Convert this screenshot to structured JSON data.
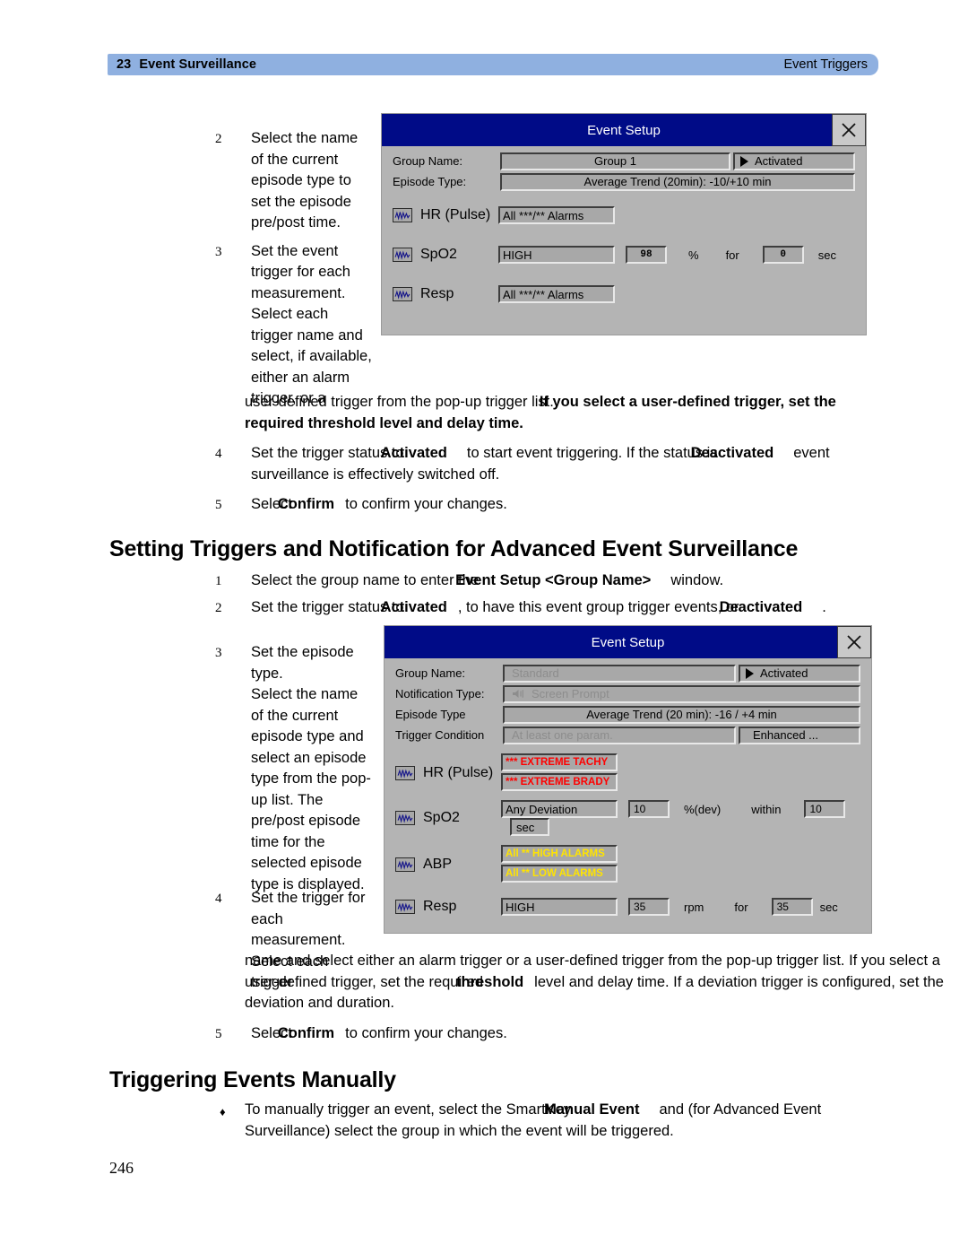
{
  "header": {
    "chapter_number": "23",
    "chapter_title": "Event Surveillance",
    "section_title": "Event Triggers"
  },
  "page_number": "246",
  "section_a": {
    "steps": [
      {
        "num": "2",
        "text": "Select the name of the current episode type to set the episode pre/post time."
      },
      {
        "num": "3",
        "text_narrow": "Set the event trigger for each measurement. Select each trigger name and select, if available, either an alarm trigger, or a",
        "text_wide_a": "user-defined trigger from the pop-up trigger list.",
        "text_wide_b": "If you select a user-defined trigger, set the required threshold level and delay time."
      },
      {
        "num": "4",
        "pre": "Set the trigger status to",
        "bold1": "Activated",
        "mid": "to start event triggering. If the status is",
        "bold2": "Deactivated",
        "post": "event surveillance is effectively switched off."
      },
      {
        "num": "5",
        "pre": "Select",
        "bold1": "Confirm",
        "mid": "to confirm your changes."
      }
    ]
  },
  "heading_advanced": "Setting Triggers and Notification for Advanced Event Surveillance",
  "section_b": {
    "steps": [
      {
        "num": "1",
        "pre": "Select the group name to enter the",
        "bold1": "Event Setup <Group Name>",
        "mid": "window."
      },
      {
        "num": "2",
        "pre": "Set the trigger status to",
        "bold1": "Activated",
        "mid": ", to have this event group trigger events, or",
        "bold2": "Deactivated",
        "post": "."
      },
      {
        "num": "3",
        "text_narrow": "Set the episode type.",
        "text_narrow2": "Select the name of the current episode type and select an episode type from the pop-up list. The pre/post episode time for the selected episode type is displayed."
      },
      {
        "num": "4",
        "text_narrow": "Set the trigger for each measurement. Select each trigger",
        "text_wide_a": "name and select either an alarm trigger or a user-defined trigger from the pop-up trigger list. If you select a user-defined trigger, set the required",
        "bold_threshold": "threshold",
        "text_wide_b": "level and delay time. If a deviation trigger is configured, set the deviation and duration."
      },
      {
        "num": "5",
        "pre": "Select",
        "bold1": "Confirm",
        "mid": "to confirm your changes."
      }
    ]
  },
  "heading_manual": "Triggering Events Manually",
  "section_c": {
    "bullet_glyph": "♦",
    "pre": "To manually trigger an event, select the SmartKey",
    "bold1": "Manual Event",
    "mid": "and (for Advanced Event Surveillance) select the group in which the event will be triggered."
  },
  "dialog_basic": {
    "title": "Event Setup",
    "close_icon": "close-icon",
    "fields": [
      {
        "label": "Group Name:",
        "value": "Group 1",
        "button": "Activated",
        "has_arrow": true
      },
      {
        "label": "Episode Type:",
        "value": "Average Trend (20min): -10/+10 min",
        "button": null
      }
    ],
    "measurements": [
      {
        "name": "HR (Pulse)",
        "icon": "waveform-icon",
        "triggers": [
          {
            "text": "All ***/** Alarms",
            "color": "normal"
          }
        ],
        "threshold": null,
        "unit": null,
        "for_label": null,
        "delay": null,
        "delay_unit": null
      },
      {
        "name": "SpO2",
        "icon": "waveform-icon",
        "triggers": [
          {
            "text": "HIGH",
            "color": "normal"
          }
        ],
        "threshold": "98",
        "unit": "%",
        "for_label": "for",
        "delay": "0",
        "delay_unit": "sec"
      },
      {
        "name": "Resp",
        "icon": "waveform-icon",
        "triggers": [
          {
            "text": "All ***/** Alarms",
            "color": "normal"
          }
        ],
        "threshold": null,
        "unit": null,
        "for_label": null,
        "delay": null,
        "delay_unit": null
      }
    ]
  },
  "dialog_advanced": {
    "title": "Event Setup",
    "close_icon": "close-icon",
    "fields": [
      {
        "label": "Group Name:",
        "value": "Standard",
        "dim": true,
        "button": "Activated",
        "has_arrow": true
      },
      {
        "label": "Notification Type:",
        "value": "Screen Prompt",
        "dim": true,
        "icon": "speaker-icon",
        "button": null
      },
      {
        "label": "Episode Type",
        "value": "Average Trend (20 min): -16 / +4 min",
        "dim": false,
        "button": null
      },
      {
        "label": "Trigger Condition",
        "value": "At least one param.",
        "dim": true,
        "button": "Enhanced ...",
        "has_arrow": false
      }
    ],
    "measurements": [
      {
        "name": "HR (Pulse)",
        "icon": "waveform-icon",
        "triggers": [
          {
            "text": "*** EXTREME TACHY",
            "color": "red"
          },
          {
            "text": "*** EXTREME BRADY",
            "color": "red"
          }
        ],
        "threshold": null,
        "unit": null,
        "for_label": null,
        "delay": null,
        "delay_unit": null
      },
      {
        "name": "SpO2",
        "icon": "waveform-icon",
        "triggers": [
          {
            "text": "Any Deviation",
            "color": "normal"
          }
        ],
        "threshold": "10",
        "unit": "%(dev)",
        "for_label": "within",
        "delay": "10",
        "delay_unit": "sec"
      },
      {
        "name": "ABP",
        "icon": "waveform-icon",
        "triggers": [
          {
            "text": "All ** HIGH ALARMS",
            "color": "yellow"
          },
          {
            "text": "All ** LOW ALARMS",
            "color": "yellow"
          }
        ],
        "threshold": null,
        "unit": null,
        "for_label": null,
        "delay": null,
        "delay_unit": null
      },
      {
        "name": "Resp",
        "icon": "waveform-icon",
        "triggers": [
          {
            "text": "HIGH",
            "color": "normal"
          }
        ],
        "threshold": "35",
        "unit": "rpm",
        "for_label": "for",
        "delay": "35",
        "delay_unit": "sec"
      }
    ]
  },
  "colors": {
    "header_band": "#8fb0e0",
    "dialog_titlebar": "#000b87",
    "dialog_face": "#b4b4b4",
    "field_face": "#a8a8a8",
    "alarm_red": "#ff0000",
    "alarm_yellow": "#ffe400"
  }
}
